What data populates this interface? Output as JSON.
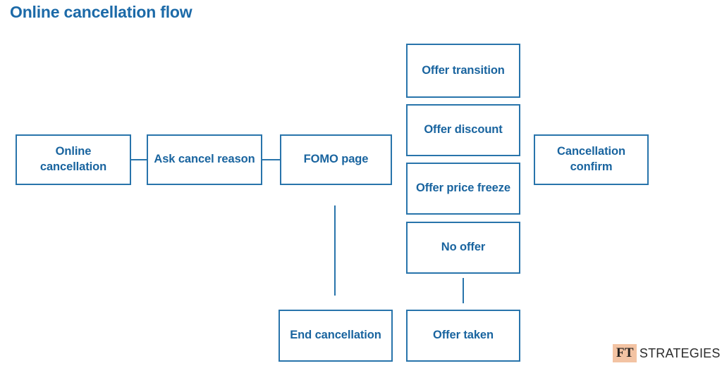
{
  "title": "Online cancellation flow",
  "colors": {
    "node_border": "#2874ab",
    "node_text": "#19649f",
    "title_text": "#1c6aa8",
    "connector": "#2874ab",
    "logo_badge_bg": "#f3c3a3",
    "logo_word_text": "#2b2b2b",
    "background": "#ffffff"
  },
  "nodes": {
    "online_cancellation": "Online cancellation",
    "ask_cancel_reason": "Ask cancel reason",
    "fomo_page": "FOMO page",
    "offer_transition": "Offer transition",
    "offer_discount": "Offer discount",
    "offer_price_freeze": "Offer price freeze",
    "no_offer": "No offer",
    "cancellation_confirm": "Cancellation confirm",
    "end_cancellation": "End cancellation",
    "offer_taken": "Offer taken"
  },
  "logo": {
    "badge": "FT",
    "word": "STRATEGIES"
  }
}
